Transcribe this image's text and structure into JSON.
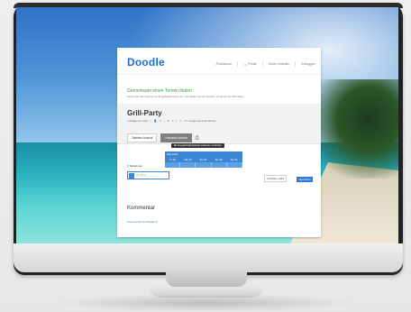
{
  "header": {
    "logo": "Doodle",
    "nav": [
      {
        "label": "Funktionen"
      },
      {
        "label": "Preise"
      },
      {
        "label": "Konto erstellen"
      },
      {
        "label": "Einloggen"
      }
    ]
  },
  "intro": {
    "title": "Gemeinsam einen Termin finden",
    "text": "Geben Sie Ihren Namen im Eingabefeld unten ein, und wählen Sie die Termine, an denen Sie Zeit haben"
  },
  "poll": {
    "title": "Grill-Party",
    "meta": {
      "author": "Umfrage von Luca",
      "participants": "0",
      "comments": "0",
      "updated": "vor weniger als einer Minute"
    },
    "tabs": [
      {
        "label": "Tabellen-Ansicht",
        "active": false
      },
      {
        "label": "Kalender-Ansicht",
        "active": true
      }
    ],
    "tooltip": "Mit Google/Outlook/Apple Kalender verbinden",
    "calendar": {
      "month": "Mai 2015",
      "days": [
        "Fr 22",
        "Sa 23",
        "So 24",
        "Sa 30",
        "So 31"
      ]
    },
    "participants_label": "0 Teilnehmer",
    "name_placeholder": "Ihr Name",
    "cant_label": "Ich kann nicht",
    "save_label": "Speichern"
  },
  "comment": {
    "title": "Kommentar",
    "add_label": "Kommentar hinzufügen"
  }
}
